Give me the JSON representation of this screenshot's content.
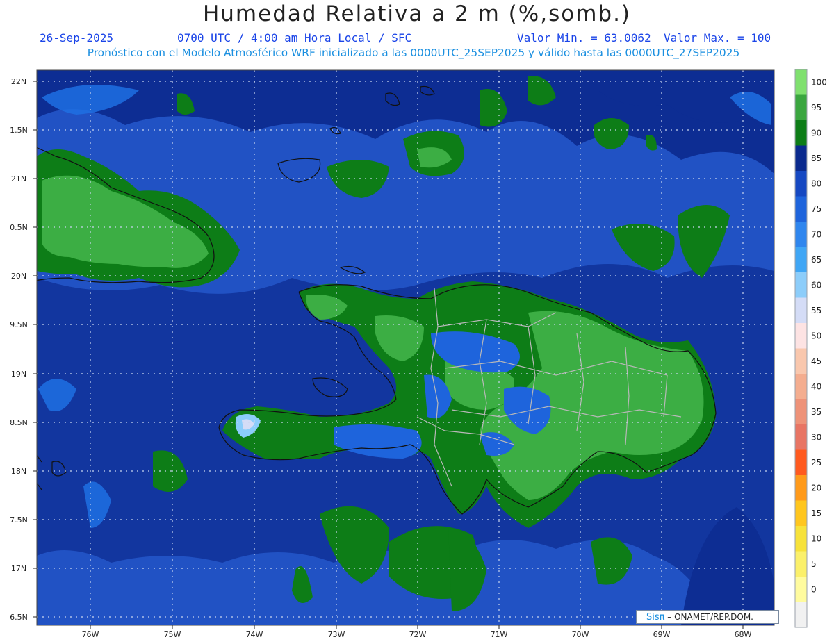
{
  "header": {
    "title": "Humedad Relativa a 2 m (%,somb.)",
    "date": "26-Sep-2025",
    "time": "0700 UTC / 4:00 am Hora Local / SFC",
    "min_label": "Valor Min. = 63.0062",
    "max_label": "Valor Max. = 100",
    "model_line": "Pronóstico con el Modelo Atmosférico WRF inicializado a las 0000UTC_25SEP2025 y válido hasta las  0000UTC_27SEP2025"
  },
  "map": {
    "lat_labels": [
      "22N",
      "1.5N",
      "21N",
      "0.5N",
      "20N",
      "9.5N",
      "19N",
      "8.5N",
      "18N",
      "7.5N",
      "17N",
      "6.5N"
    ],
    "lon_labels": [
      "76W",
      "75W",
      "74W",
      "73W",
      "72W",
      "71W",
      "70W",
      "69W",
      "68W"
    ],
    "background_color": "#2152c4",
    "land_color": "#33a845"
  },
  "colorbar": {
    "labels": [
      "100",
      "95",
      "90",
      "85",
      "80",
      "75",
      "70",
      "65",
      "60",
      "55",
      "50",
      "45",
      "40",
      "35",
      "30",
      "25",
      "20",
      "15",
      "10",
      "5",
      "0"
    ],
    "colors": [
      "#7fe06e",
      "#3aa63f",
      "#0d7d17",
      "#0a2a8e",
      "#1548c2",
      "#1e64dc",
      "#2f86ee",
      "#3fa6f5",
      "#8ccdfa",
      "#d4dcf6",
      "#fde3e3",
      "#f9c7ad",
      "#f4ad8f",
      "#ee9278",
      "#e87564",
      "#ff5a1f",
      "#ff9a1a",
      "#ffc61e",
      "#f7e23a",
      "#fbf06a",
      "#fffb9e",
      "#f1f1f1"
    ]
  },
  "credit": {
    "brand": "Sisπ",
    "text": " – ONAMET/REP.DOM."
  }
}
